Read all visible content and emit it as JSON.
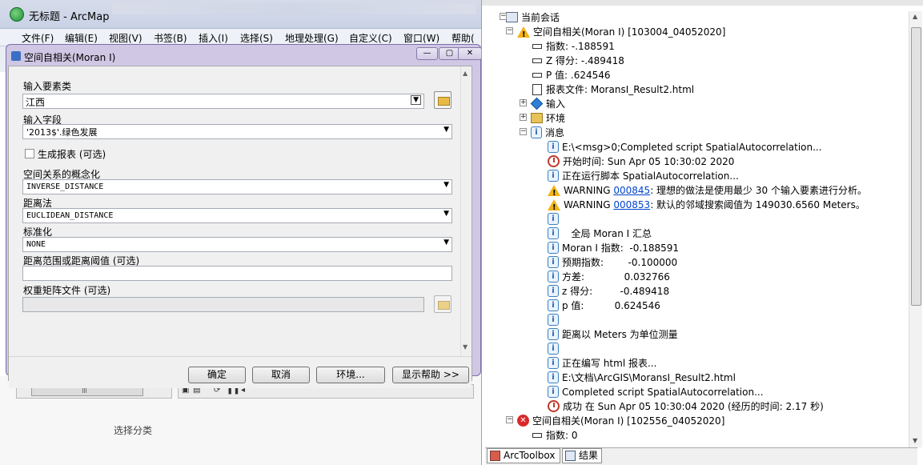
{
  "app": {
    "title": "无标题 - ArcMap",
    "menu": [
      "文件(F)",
      "编辑(E)",
      "视图(V)",
      "书签(B)",
      "插入(I)",
      "选择(S)",
      "地理处理(G)",
      "自定义(C)",
      "窗口(W)",
      "帮助("
    ],
    "select_category": "选择分类"
  },
  "dialog": {
    "title": "空间自相关(Moran I)",
    "fields": {
      "input_features_label": "输入要素类",
      "input_features_value": "江西",
      "input_field_label": "输入字段",
      "input_field_value": "'2013$'.绿色发展",
      "generate_report_label": "生成报表 (可选)",
      "conceptualization_label": "空间关系的概念化",
      "conceptualization_value": "INVERSE_DISTANCE",
      "distance_method_label": "距离法",
      "distance_method_value": "EUCLIDEAN_DISTANCE",
      "standardization_label": "标准化",
      "standardization_value": "NONE",
      "distance_threshold_label": "距离范围或距离阈值 (可选)",
      "weights_file_label": "权重矩阵文件 (可选)"
    },
    "buttons": {
      "ok": "确定",
      "cancel": "取消",
      "env": "环境...",
      "help": "显示帮助 >>"
    }
  },
  "results": {
    "current_session": "当前会话",
    "item1": {
      "title": "空间自相关(Moran I) [103004_04052020]",
      "index": "指数: -.188591",
      "zscore": "Z 得分: -.489418",
      "pvalue": "P 值: .624546",
      "report": "报表文件: MoransI_Result2.html",
      "inputs": "输入",
      "environments": "环境",
      "messages": "消息",
      "msgs": [
        {
          "icon": "info",
          "text": "E:\\<msg>0;Completed script SpatialAutocorrelation..."
        },
        {
          "icon": "clock",
          "text": "开始时间: Sun Apr 05 10:30:02 2020"
        },
        {
          "icon": "info",
          "text": "正在运行脚本 SpatialAutocorrelation..."
        },
        {
          "icon": "warn",
          "pre": "WARNING ",
          "code": "000845",
          "text": ": 理想的做法是使用最少 30 个输入要素进行分析。"
        },
        {
          "icon": "warn",
          "pre": "WARNING ",
          "code": "000853",
          "text": ": 默认的邻域搜索阈值为 149030.6560 Meters。"
        },
        {
          "icon": "info",
          "text": ""
        },
        {
          "icon": "info",
          "text": "   全局 Moran I 汇总"
        },
        {
          "icon": "info",
          "text": "Moran I 指数:  -0.188591"
        },
        {
          "icon": "info",
          "text": "预期指数:        -0.100000"
        },
        {
          "icon": "info",
          "text": "方差:             0.032766"
        },
        {
          "icon": "info",
          "text": "z 得分:         -0.489418"
        },
        {
          "icon": "info",
          "text": "p 值:          0.624546"
        },
        {
          "icon": "info",
          "text": ""
        },
        {
          "icon": "info",
          "text": "距离以 Meters 为单位测量"
        },
        {
          "icon": "info",
          "text": ""
        },
        {
          "icon": "info",
          "text": "正在编写 html 报表..."
        },
        {
          "icon": "info",
          "text": "E:\\文档\\ArcGIS\\MoransI_Result2.html"
        },
        {
          "icon": "info",
          "text": "Completed script SpatialAutocorrelation..."
        },
        {
          "icon": "clock",
          "text": "成功 在 Sun Apr 05 10:30:04 2020 (经历的时间: 2.17 秒)"
        }
      ]
    },
    "item2": {
      "title": "空间自相关(Moran I) [102556_04052020]",
      "index": "指数: 0"
    },
    "tabs": {
      "arctoolbox": "ArcToolbox",
      "results": "结果"
    }
  }
}
